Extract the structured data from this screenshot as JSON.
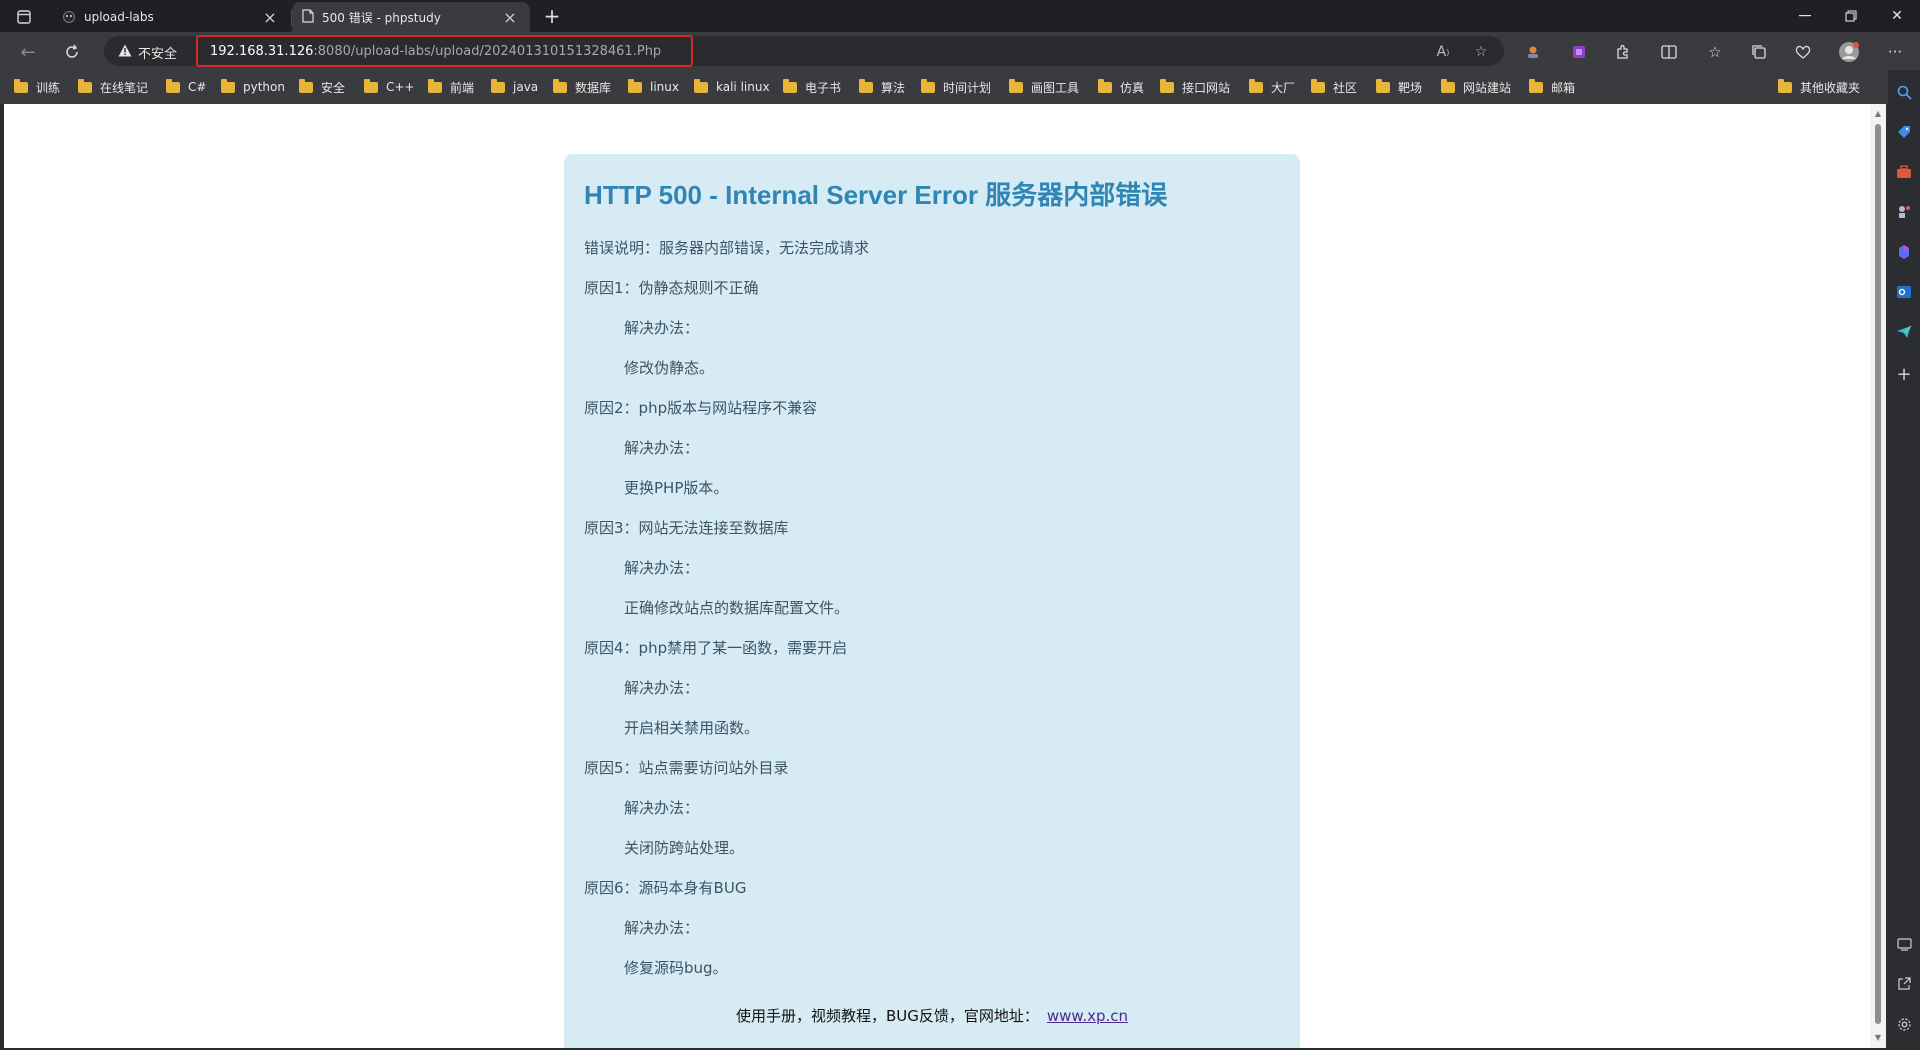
{
  "tabs": [
    {
      "title": "upload-labs",
      "active": false
    },
    {
      "title": "500 错误 - phpstudy",
      "active": true
    }
  ],
  "address_bar": {
    "security_label": "不安全",
    "url_host": "192.168.31.126",
    "url_path": ":8080/upload-labs/upload/202401310151328461.Php"
  },
  "bookmarks": [
    "训练",
    "在线笔记",
    "C#",
    "python",
    "安全",
    "C++",
    "前端",
    "java",
    "数据库",
    "linux",
    "kali linux",
    "电子书",
    "算法",
    "时间计划",
    "画图工具",
    "仿真",
    "接口网站",
    "大厂",
    "社区",
    "靶场",
    "网站建站",
    "邮箱"
  ],
  "other_bookmarks": "其他收藏夹",
  "page": {
    "title": "HTTP 500 - Internal Server Error 服务器内部错误",
    "description": "错误说明：服务器内部错误，无法完成请求",
    "reasons": [
      {
        "reason": "原因1：伪静态规则不正确",
        "fix_label": "解决办法：",
        "fix": "修改伪静态。"
      },
      {
        "reason": "原因2：php版本与网站程序不兼容",
        "fix_label": "解决办法：",
        "fix": "更换PHP版本。"
      },
      {
        "reason": "原因3：网站无法连接至数据库",
        "fix_label": "解决办法：",
        "fix": "正确修改站点的数据库配置文件。"
      },
      {
        "reason": "原因4：php禁用了某一函数，需要开启",
        "fix_label": "解决办法：",
        "fix": "开启相关禁用函数。"
      },
      {
        "reason": "原因5：站点需要访问站外目录",
        "fix_label": "解决办法：",
        "fix": "关闭防跨站处理。"
      },
      {
        "reason": "原因6：源码本身有BUG",
        "fix_label": "解决办法：",
        "fix": "修复源码bug。"
      }
    ],
    "footer_text": "使用手册，视频教程，BUG反馈，官网地址：",
    "footer_link": "www.xp.cn"
  },
  "colors": {
    "card_bg": "#d7ebf5",
    "title": "#2f86b4",
    "url_highlight_border": "#d22a2a",
    "chrome_dark": "#1f2023",
    "chrome_toolbar": "#3a3b3f"
  }
}
